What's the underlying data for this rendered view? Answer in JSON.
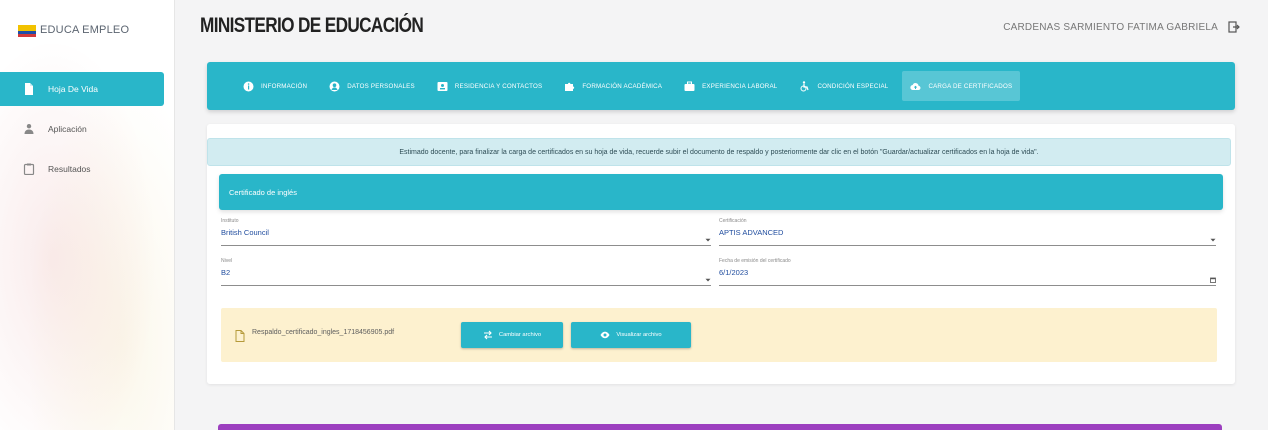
{
  "brand": {
    "name": "EDUCA EMPLEO",
    "logo_icon": "ecuador-flag-logo"
  },
  "sidebar": {
    "items": [
      {
        "label": "Hoja De Vida",
        "icon": "document-icon",
        "active": true
      },
      {
        "label": "Aplicación",
        "icon": "person-icon",
        "active": false
      },
      {
        "label": "Resultados",
        "icon": "clipboard-icon",
        "active": false
      }
    ]
  },
  "header": {
    "title": "MINISTERIO DE EDUCACIÓN",
    "user": "CARDENAS SARMIENTO FATIMA GABRIELA",
    "logout_icon": "logout-icon"
  },
  "tabs": [
    {
      "label": "Información",
      "icon": "info-icon",
      "active": false
    },
    {
      "label": "Datos personales",
      "icon": "account-circle-icon",
      "active": false
    },
    {
      "label": "Residencia y contactos",
      "icon": "contact-card-icon",
      "active": false
    },
    {
      "label": "Formación académica",
      "icon": "puzzle-icon",
      "active": false
    },
    {
      "label": "Experiencia laboral",
      "icon": "briefcase-icon",
      "active": false
    },
    {
      "label": "Condición especial",
      "icon": "wheelchair-icon",
      "active": false
    },
    {
      "label": "Carga de certificados",
      "icon": "cloud-upload-icon",
      "active": true
    }
  ],
  "notice": "Estimado docente, para finalizar la carga de certificados en su hoja de vida, recuerde subir el documento de respaldo y posteriormente dar clic en el botón \"Guardar/actualizar certificados en la hoja de vida\".",
  "section": {
    "title": "Certificado de inglés"
  },
  "form": {
    "instituto": {
      "label": "Instituto",
      "value": "British Council"
    },
    "certificacion": {
      "label": "Certificación",
      "value": "APTIS ADVANCED"
    },
    "nivel": {
      "label": "Nivel",
      "value": "B2"
    },
    "fecha": {
      "label": "Fecha de emisión del certificado",
      "value": "6/1/2023"
    }
  },
  "file": {
    "name": "Respaldo_certificado_ingles_1718456905.pdf",
    "change_label": "Cambiar archivo",
    "view_label": "Visualizar archivo"
  },
  "colors": {
    "primary": "#29b6c9",
    "notice_bg": "#d2ecf1",
    "file_bg": "#fdf1cf",
    "bottom_accent": "#9c3fbf"
  }
}
